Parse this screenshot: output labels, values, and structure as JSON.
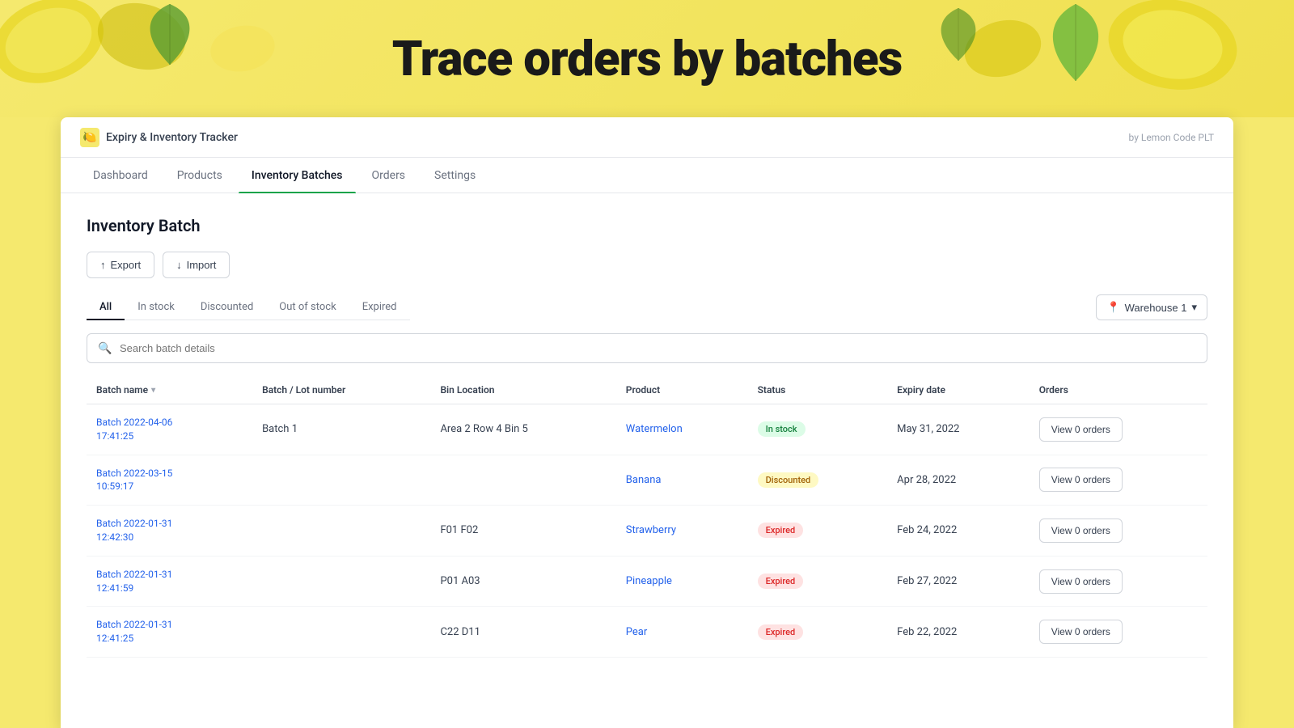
{
  "page": {
    "hero_title": "Trace orders by batches",
    "app_name": "Expiry & Inventory Tracker",
    "attribution": "by Lemon Code PLT"
  },
  "nav": {
    "items": [
      {
        "label": "Dashboard",
        "active": false
      },
      {
        "label": "Products",
        "active": false
      },
      {
        "label": "Inventory Batches",
        "active": true
      },
      {
        "label": "Orders",
        "active": false
      },
      {
        "label": "Settings",
        "active": false
      }
    ]
  },
  "inventory": {
    "section_title": "Inventory Batch",
    "export_label": "Export",
    "import_label": "Import",
    "search_placeholder": "Search batch details",
    "filter_tabs": [
      {
        "label": "All",
        "active": true
      },
      {
        "label": "In stock",
        "active": false
      },
      {
        "label": "Discounted",
        "active": false
      },
      {
        "label": "Out of stock",
        "active": false
      },
      {
        "label": "Expired",
        "active": false
      }
    ],
    "warehouse": {
      "label": "Warehouse 1",
      "icon": "📍"
    },
    "table": {
      "headers": [
        "Batch name",
        "Batch / Lot number",
        "Bin Location",
        "Product",
        "Status",
        "Expiry date",
        "Orders"
      ],
      "rows": [
        {
          "batch_name": "Batch 2022-04-06 17:41:25",
          "lot_number": "Batch 1",
          "bin_location": "Area 2 Row 4 Bin 5",
          "product": "Watermelon",
          "status": "In stock",
          "status_type": "instock",
          "expiry_date": "May 31, 2022",
          "orders_label": "View 0 orders"
        },
        {
          "batch_name": "Batch 2022-03-15 10:59:17",
          "lot_number": "",
          "bin_location": "",
          "product": "Banana",
          "status": "Discounted",
          "status_type": "discounted",
          "expiry_date": "Apr 28, 2022",
          "orders_label": "View 0 orders"
        },
        {
          "batch_name": "Batch 2022-01-31 12:42:30",
          "lot_number": "",
          "bin_location": "F01 F02",
          "product": "Strawberry",
          "status": "Expired",
          "status_type": "expired",
          "expiry_date": "Feb 24, 2022",
          "orders_label": "View 0 orders"
        },
        {
          "batch_name": "Batch 2022-01-31 12:41:59",
          "lot_number": "",
          "bin_location": "P01 A03",
          "product": "Pineapple",
          "status": "Expired",
          "status_type": "expired",
          "expiry_date": "Feb 27, 2022",
          "orders_label": "View 0 orders"
        },
        {
          "batch_name": "Batch 2022-01-31 12:41:25",
          "lot_number": "",
          "bin_location": "C22 D11",
          "product": "Pear",
          "status": "Expired",
          "status_type": "expired",
          "expiry_date": "Feb 22, 2022",
          "orders_label": "View 0 orders"
        }
      ]
    }
  }
}
